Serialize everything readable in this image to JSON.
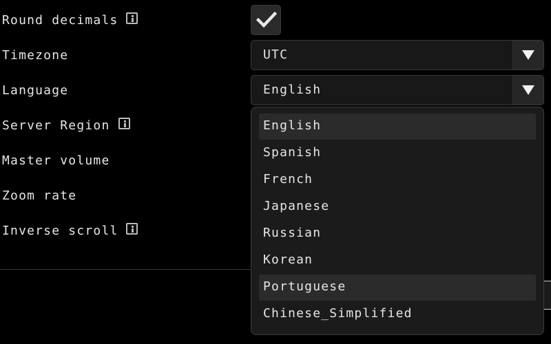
{
  "settings": {
    "labels": {
      "round_decimals": "Round decimals",
      "timezone": "Timezone",
      "language": "Language",
      "server_region": "Server Region",
      "master_volume": "Master volume",
      "zoom_rate": "Zoom rate",
      "inverse_scroll": "Inverse scroll"
    },
    "round_decimals_checked": true,
    "timezone_value": "UTC",
    "language_value": "English"
  },
  "language_menu": {
    "options": [
      "English",
      "Spanish",
      "French",
      "Japanese",
      "Russian",
      "Korean",
      "Portuguese",
      "Chinese_Simplified"
    ],
    "selected": "English",
    "hovered": "Portuguese"
  },
  "icons": {
    "info": "info-icon",
    "check": "checkmark-icon",
    "dropdown": "triangle-down-icon"
  },
  "colors": {
    "background": "#000000",
    "text": "#e6e6e6",
    "control_bg": "#181818",
    "menu_bg": "#1b1b1b",
    "highlight": "#2b2b2b",
    "border": "#3a3a3a"
  }
}
